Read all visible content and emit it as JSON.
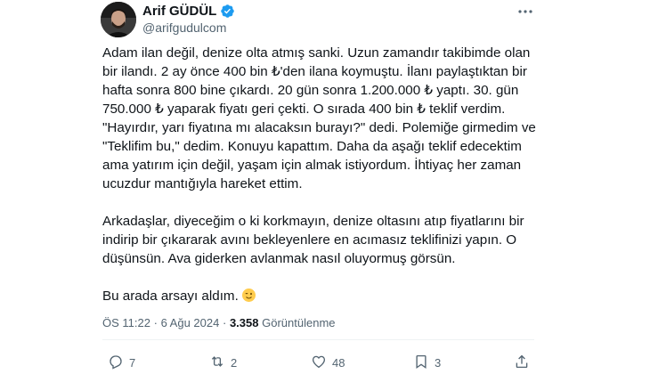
{
  "author": {
    "name": "Arif GÜDÜL",
    "handle": "@arifgudulcom"
  },
  "tweet": {
    "paragraphs": [
      "Adam ilan değil, denize olta atmış sanki. Uzun zamandır takibimde olan bir ilandı. 2 ay önce 400 bin ₺'den ilana koymuştu. İlanı paylaştıktan bir hafta sonra 800 bine çıkardı. 20 gün sonra 1.200.000 ₺ yaptı. 30. gün 750.000 ₺ yaparak fiyatı geri çekti. O sırada 400 bin ₺ teklif verdim. \"Hayırdır, yarı fiyatına mı alacaksın burayı?\" dedi. Polemiğe girmedim ve \"Teklifim bu,\" dedim. Konuyu kapattım. Daha da aşağı teklif edecektim ama yatırım için değil, yaşam için almak istiyordum. İhtiyaç her zaman ucuzdur mantığıyla hareket ettim.",
      "Arkadaşlar, diyeceğim o ki korkmayın, denize oltasını atıp fiyatlarını bir indirip bir çıkararak avını bekleyenlere en acımasız teklifinizi yapın. O düşünsün. Ava giderken avlanmak nasıl oluyormuş görsün.",
      "Bu arada arsayı aldım."
    ],
    "emoji": "winking-face-emoji"
  },
  "meta": {
    "time": "ÖS 11:22",
    "separator": "·",
    "date": "6 Ağu 2024",
    "views_count": "3.358",
    "views_label": "Görüntülenme"
  },
  "actions": {
    "reply_count": "7",
    "retweet_count": "2",
    "like_count": "48",
    "bookmark_count": "3"
  },
  "colors": {
    "verified": "#1d9bf0",
    "secondary_text": "#536471",
    "primary_text": "#0f1419"
  },
  "icons": [
    "verified-badge-icon",
    "more-options-icon",
    "reply-icon",
    "retweet-icon",
    "like-icon",
    "bookmark-icon",
    "share-icon"
  ]
}
